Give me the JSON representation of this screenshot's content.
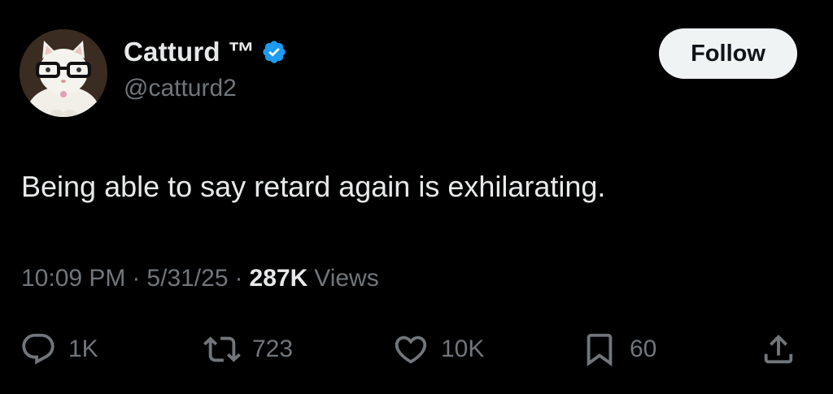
{
  "author": {
    "display_name": "Catturd ™",
    "handle": "@catturd2",
    "verified": true,
    "verified_color": "#1d9bf0"
  },
  "follow_button": {
    "label": "Follow"
  },
  "tweet": {
    "text": "Being able to say retard again is exhilarating."
  },
  "meta": {
    "time": "10:09 PM",
    "separator": "·",
    "date": "5/31/25",
    "views_count": "287K",
    "views_label": "Views"
  },
  "actions": {
    "reply": {
      "icon": "reply-icon",
      "count": "1K"
    },
    "retweet": {
      "icon": "retweet-icon",
      "count": "723"
    },
    "like": {
      "icon": "heart-icon",
      "count": "10K"
    },
    "bookmark": {
      "icon": "bookmark-icon",
      "count": "60"
    },
    "share": {
      "icon": "share-icon"
    }
  },
  "colors": {
    "background": "#000000",
    "primary_text": "#e7e9ea",
    "secondary_text": "#71767b",
    "follow_bg": "#eff3f4"
  }
}
